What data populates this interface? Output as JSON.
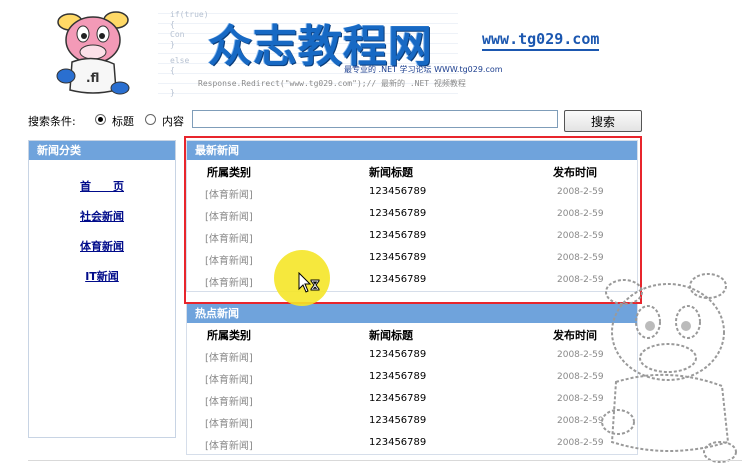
{
  "header": {
    "site_title": "众志教程网",
    "site_url": "www.tg029.com",
    "slogan": "最专业的 .NET 学习论坛 WWW.tg029.com",
    "code_lines": [
      "if(true)",
      "{",
      "    Con",
      "}",
      "else",
      "{",
      "}"
    ],
    "code_footer": "Response.Redirect(\"www.tg029.com\");// 最新的 .NET 视频教程"
  },
  "search": {
    "label": "搜索条件:",
    "option_title": "标题",
    "option_content": "内容",
    "input_value": "",
    "button_label": "搜索"
  },
  "sidebar": {
    "title": "新闻分类",
    "items": [
      "首　　页",
      "社会新闻",
      "体育新闻",
      "IT新闻"
    ]
  },
  "latest_news": {
    "title": "最新新闻",
    "columns": [
      "所属类别",
      "新闻标题",
      "发布时间"
    ],
    "rows": [
      {
        "category": "[体育新闻]",
        "title": "123456789",
        "date": "2008-2-59"
      },
      {
        "category": "[体育新闻]",
        "title": "123456789",
        "date": "2008-2-59"
      },
      {
        "category": "[体育新闻]",
        "title": "123456789",
        "date": "2008-2-59"
      },
      {
        "category": "[体育新闻]",
        "title": "123456789",
        "date": "2008-2-59"
      },
      {
        "category": "[体育新闻]",
        "title": "123456789",
        "date": "2008-2-59"
      }
    ]
  },
  "hot_news": {
    "title": "热点新闻",
    "columns": [
      "所属类别",
      "新闻标题",
      "发布时间"
    ],
    "rows": [
      {
        "category": "[体育新闻]",
        "title": "123456789",
        "date": "2008-2-59"
      },
      {
        "category": "[体育新闻]",
        "title": "123456789",
        "date": "2008-2-59"
      },
      {
        "category": "[体育新闻]",
        "title": "123456789",
        "date": "2008-2-59"
      },
      {
        "category": "[体育新闻]",
        "title": "123456789",
        "date": "2008-2-59"
      },
      {
        "category": "[体育新闻]",
        "title": "123456789",
        "date": "2008-2-59"
      }
    ]
  },
  "colors": {
    "panel_header": "#6fa3dc",
    "title_blue": "#1769c4",
    "link_blue": "#000b8a",
    "highlight_red": "#e8252c",
    "cursor_halo": "#f5e528"
  },
  "icons": {
    "mascot": "cow-mascot-icon",
    "cursor": "busy-arrow-cursor-icon",
    "watermark": "cow-outline-watermark-icon"
  }
}
